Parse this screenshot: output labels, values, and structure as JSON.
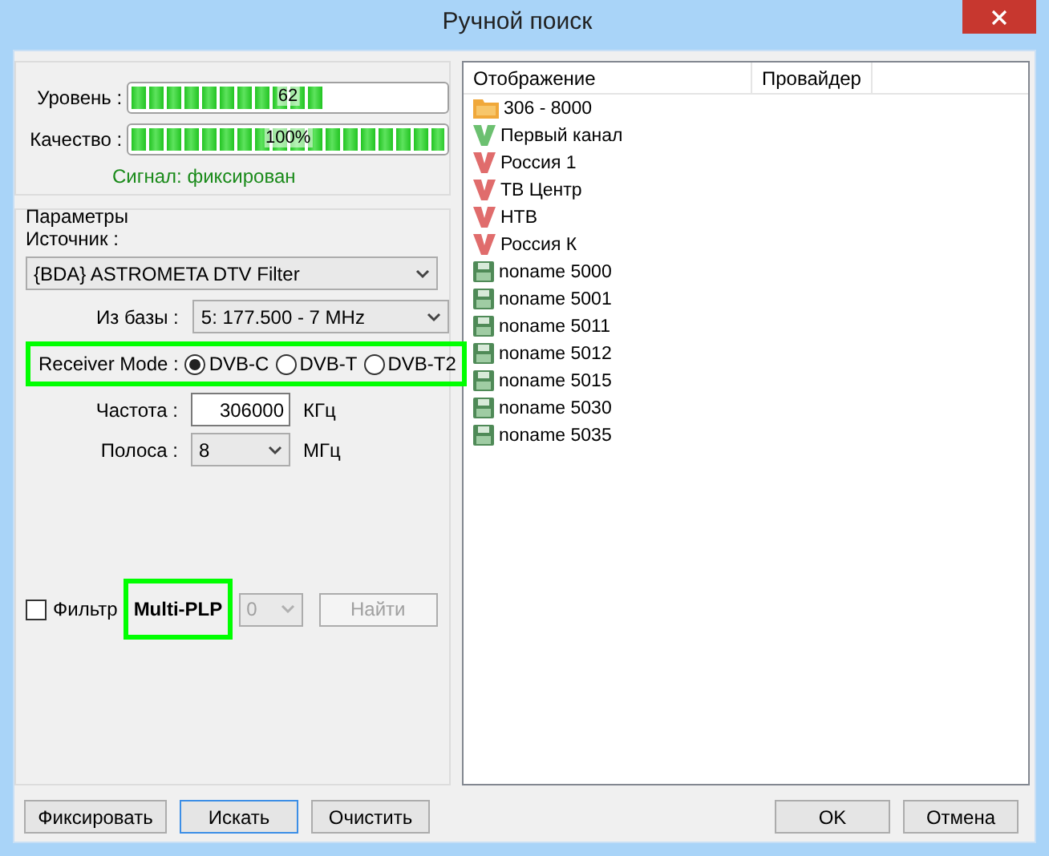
{
  "window": {
    "title": "Ручной поиск"
  },
  "signal": {
    "meters": [
      {
        "label": "Уровень :",
        "level": 0.62,
        "reading": "62"
      },
      {
        "label": "Качество :",
        "level": 1,
        "reading": "100%"
      }
    ],
    "status": "Сигнал: фиксирован"
  },
  "parameters": {
    "title": "Параметры",
    "source_label": "Источник :",
    "source": "{BDA} ASTROMETA DTV Filter",
    "base_label": "Из базы :",
    "base": "5: 177.500 - 7 MHz",
    "receiver_mode": {
      "label": "Receiver Mode :",
      "options": [
        {
          "label": "DVB-C",
          "selected": true
        },
        {
          "label": "DVB-T",
          "selected": false
        },
        {
          "label": "DVB-T2",
          "selected": false
        }
      ]
    },
    "frequency": {
      "label": "Частота :",
      "value": "306000",
      "unit": "КГц"
    },
    "band": {
      "label": "Полоса :",
      "value": "8",
      "unit": "МГц"
    },
    "filter": {
      "label": "Фильтр",
      "checked": false
    },
    "plp": {
      "label": "Multi-PLP",
      "value": "0",
      "disabled": true
    },
    "find_button": {
      "label": "Найти",
      "disabled": true
    }
  },
  "table": {
    "columns": [
      "Отображение",
      "Провайдер"
    ],
    "rows": [
      {
        "kind": "folder",
        "name": "306 - 8000"
      },
      {
        "kind": "v",
        "color": "#6cc070",
        "name": "Первый канал"
      },
      {
        "kind": "v",
        "color": "#e06c6c",
        "name": "Россия 1"
      },
      {
        "kind": "v",
        "color": "#e06c6c",
        "name": "ТВ Центр"
      },
      {
        "kind": "v",
        "color": "#e06c6c",
        "name": "НТВ"
      },
      {
        "kind": "v",
        "color": "#e06c6c",
        "name": "Россия К"
      },
      {
        "kind": "disk",
        "name": "noname 5000"
      },
      {
        "kind": "disk",
        "name": "noname 5001"
      },
      {
        "kind": "disk",
        "name": "noname 5011"
      },
      {
        "kind": "disk",
        "name": "noname 5012"
      },
      {
        "kind": "disk",
        "name": "noname 5015"
      },
      {
        "kind": "disk",
        "name": "noname 5030"
      },
      {
        "kind": "disk",
        "name": "noname 5035"
      }
    ]
  },
  "buttons": [
    {
      "label": "Фиксировать",
      "selected": false
    },
    {
      "label": "Искать",
      "selected": true
    },
    {
      "label": "Очистить",
      "selected": false
    }
  ],
  "dialog_buttons": [
    "OK",
    "Отмена"
  ]
}
